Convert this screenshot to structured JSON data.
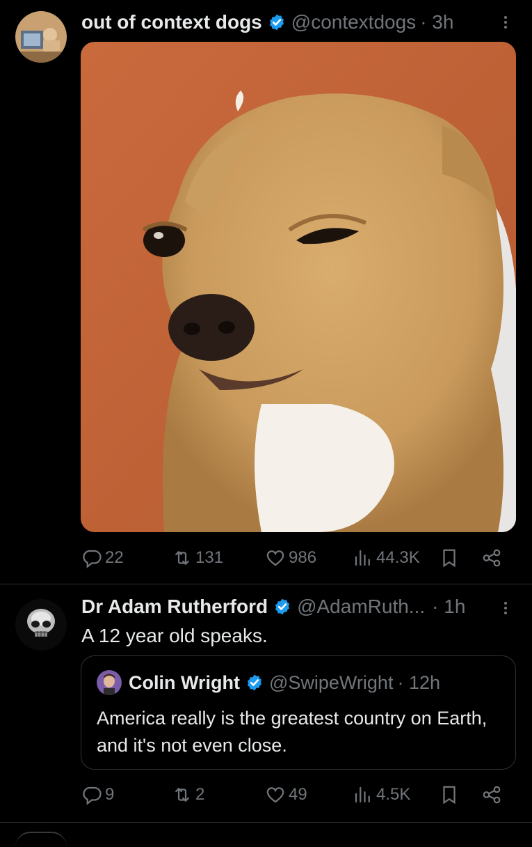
{
  "tweet1": {
    "name": "out of context dogs",
    "handle": "@contextdogs",
    "time": "· 3h",
    "image_alt": "Photo of a tan chihuahua dog squinting one eye",
    "stats": {
      "replies": "22",
      "reposts": "131",
      "likes": "986",
      "views": "44.3K"
    }
  },
  "tweet2": {
    "name": "Dr Adam Rutherford",
    "handle": "@AdamRuth...",
    "time": "· 1h",
    "text": "A 12 year old speaks.",
    "quote": {
      "name": "Colin Wright",
      "handle": "@SwipeWright",
      "time": "· 12h",
      "text": "America really is the greatest country on Earth, and it's not even close."
    },
    "stats": {
      "replies": "9",
      "reposts": "2",
      "likes": "49",
      "views": "4.5K"
    }
  },
  "colors": {
    "verified": "#1d9bf0",
    "muted": "#71767b",
    "background": "#000000"
  }
}
